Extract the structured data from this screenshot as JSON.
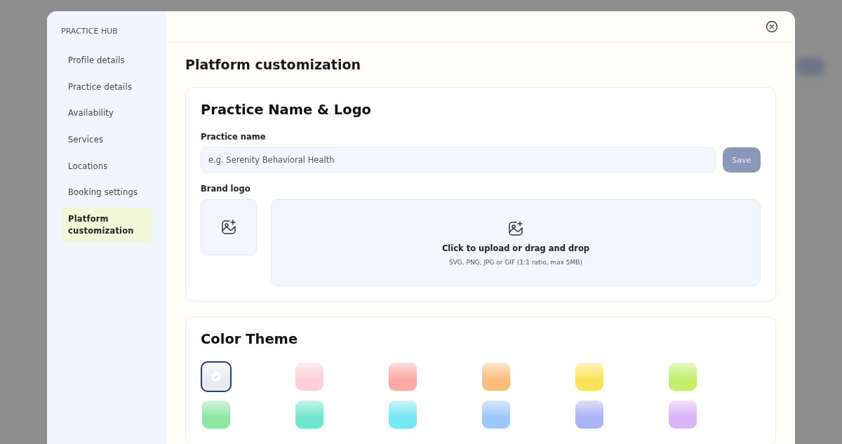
{
  "sidebar": {
    "title": "PRACTICE HUB",
    "items": [
      {
        "label": "Profile details",
        "selected": false
      },
      {
        "label": "Practice details",
        "selected": false
      },
      {
        "label": "Availability",
        "selected": false
      },
      {
        "label": "Services",
        "selected": false
      },
      {
        "label": "Locations",
        "selected": false
      },
      {
        "label": "Booking settings",
        "selected": false
      },
      {
        "label": "Platform customization",
        "selected": true
      }
    ]
  },
  "page_title": "Platform customization",
  "name_logo": {
    "title": "Practice Name & Logo",
    "name_label": "Practice name",
    "name_placeholder": "e.g. Serenity Behavioral Health",
    "save_button": "Save",
    "logo_label": "Brand logo",
    "upload_title": "Click to upload or drag and drop",
    "upload_hint": "SVG, PNG, JPG or GIF (1:1 ratio, max 5MB)"
  },
  "color_theme": {
    "title": "Color Theme",
    "swatches": [
      {
        "color": "#e9eaee",
        "selected": true
      },
      {
        "color": "#fdd0d5",
        "selected": false
      },
      {
        "color": "#fba9a5",
        "selected": false
      },
      {
        "color": "#fdbe7b",
        "selected": false
      },
      {
        "color": "#fde35a",
        "selected": false
      },
      {
        "color": "#c2ee6a",
        "selected": false
      },
      {
        "color": "#8ee6a3",
        "selected": false
      },
      {
        "color": "#6ee6cb",
        "selected": false
      },
      {
        "color": "#78e6f5",
        "selected": false
      },
      {
        "color": "#9cc8fb",
        "selected": false
      },
      {
        "color": "#a9b3f6",
        "selected": false
      },
      {
        "color": "#dab4f8",
        "selected": false
      }
    ]
  }
}
